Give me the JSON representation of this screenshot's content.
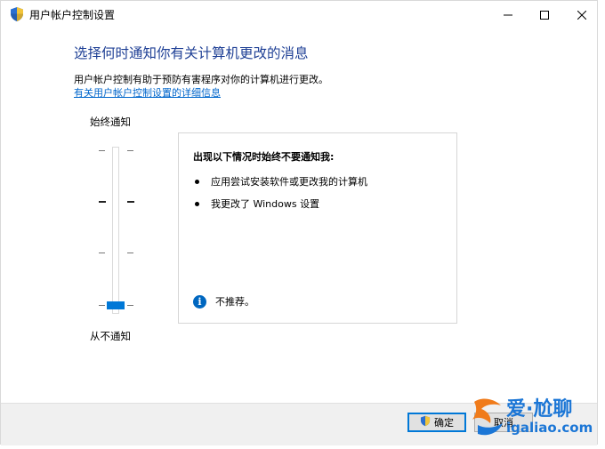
{
  "window": {
    "title": "用户帐户控制设置",
    "controls": {
      "minimize": "minimize",
      "maximize": "maximize",
      "close": "close"
    }
  },
  "header": {
    "heading": "选择何时通知你有关计算机更改的消息",
    "description": "用户帐户控制有助于预防有害程序对你的计算机进行更改。",
    "link": "有关用户帐户控制设置的详细信息"
  },
  "slider": {
    "top_label": "始终通知",
    "bottom_label": "从不通知",
    "level_index": 0,
    "levels_count": 4
  },
  "panel": {
    "title": "出现以下情况时始终不要通知我:",
    "bullets": [
      "应用尝试安装软件或更改我的计算机",
      "我更改了 Windows 设置"
    ],
    "note": "不推荐。"
  },
  "footer": {
    "ok_label": "确定",
    "cancel_label": "取消"
  },
  "watermark": {
    "line1": "爱·尬聊",
    "line2": "igaliao.com"
  },
  "colors": {
    "heading": "#1e3f95",
    "link": "#0066cc",
    "accent": "#0078d7"
  }
}
